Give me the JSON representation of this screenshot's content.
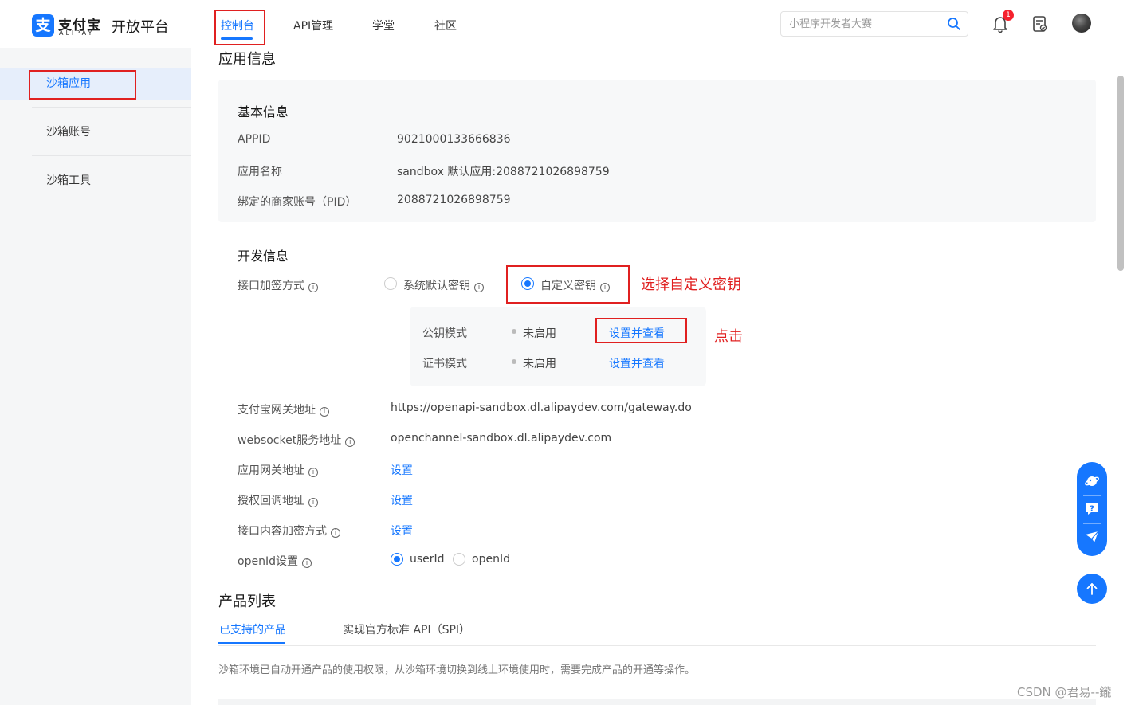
{
  "header": {
    "logo_cn": "支付宝",
    "logo_en": "ALIPAY",
    "logo_glyph": "支",
    "platform": "开放平台",
    "nav": [
      {
        "label": "控制台",
        "active": true
      },
      {
        "label": "API管理"
      },
      {
        "label": "学堂"
      },
      {
        "label": "社区"
      }
    ],
    "search_placeholder": "小程序开发者大赛",
    "notification_count": "1",
    "icons": [
      "search-icon",
      "bell-icon",
      "document-icon",
      "avatar"
    ]
  },
  "sidebar": {
    "items": [
      {
        "label": "沙箱应用",
        "active": true
      },
      {
        "label": "沙箱账号"
      },
      {
        "label": "沙箱工具"
      }
    ]
  },
  "app_info": {
    "title": "应用信息",
    "basic": {
      "title": "基本信息",
      "rows": [
        {
          "label": "APPID",
          "value": "9021000133666836"
        },
        {
          "label": "应用名称",
          "value": "sandbox 默认应用:2088721026898759"
        },
        {
          "label": "绑定的商家账号（PID）",
          "value": "2088721026898759"
        }
      ]
    },
    "dev": {
      "title": "开发信息",
      "sign_label": "接口加签方式",
      "sign_options": [
        {
          "label": "系统默认密钥",
          "checked": false
        },
        {
          "label": "自定义密钥",
          "checked": true
        }
      ],
      "key_modes": [
        {
          "label": "公钥模式",
          "status": "未启用",
          "action": "设置并查看"
        },
        {
          "label": "证书模式",
          "status": "未启用",
          "action": "设置并查看"
        }
      ],
      "gateway_label": "支付宝网关地址",
      "gateway_value": "https://openapi-sandbox.dl.alipaydev.com/gateway.do",
      "websocket_label": "websocket服务地址",
      "websocket_value": "openchannel-sandbox.dl.alipaydev.com",
      "app_gateway_label": "应用网关地址",
      "auth_callback_label": "授权回调地址",
      "content_encrypt_label": "接口内容加密方式",
      "set_label": "设置",
      "openid_label": "openId设置",
      "openid_options": [
        {
          "label": "userId",
          "checked": true
        },
        {
          "label": "openId",
          "checked": false
        }
      ]
    }
  },
  "annotations": {
    "choose_custom_key": "选择自定义密钥",
    "click": "点击"
  },
  "products": {
    "title": "产品列表",
    "tabs": [
      {
        "label": "已支持的产品",
        "active": true
      },
      {
        "label": "实现官方标准 API（SPI）"
      }
    ],
    "note": "沙箱环境已自动开通产品的使用权限，从沙箱环境切换到线上环境使用时，需要完成产品的开通等操作。"
  },
  "watermark": "CSDN @君易--鑨",
  "colors": {
    "accent": "#1677ff",
    "annotation": "#e02020",
    "badge": "#f5222d"
  }
}
